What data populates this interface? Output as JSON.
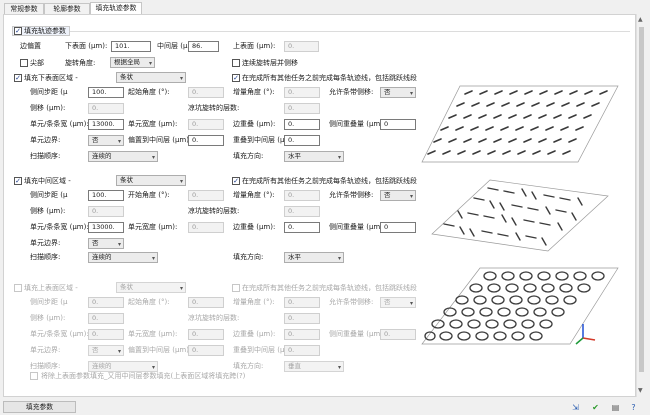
{
  "tabs": [
    "常规参数",
    "轮廓参数",
    "填充轨迹参数"
  ],
  "header": {
    "label": "填充轨迹参数",
    "checked": true
  },
  "top": {
    "l_offset": "边偏置",
    "l_lower": "下表面 (μm):",
    "lower_val": "101.",
    "l_mid": "中间层 (μ",
    "mid_val": "86.",
    "l_upper": "上表面 (μm):",
    "upper_val": "0.",
    "l_tip": "尖部",
    "l_rot": "旋转角度:",
    "rot_sel": "根据全局",
    "l_cont": "连续旋转层并侧移"
  },
  "sections": [
    {
      "title": "填充下表面区域 -",
      "style": "条状",
      "sync": "在完成所有其他任务之前完成每条轨迹线，包括跳跃线段",
      "l_side": "侧间步距 (μ",
      "side_val": "100.",
      "l_start": "起始角度 (°):",
      "start_val": "0.",
      "l_inc": "增量角度 (°):",
      "inc_val": "0.",
      "l_allow": "允许条带侧移:",
      "allow_sel": "否",
      "l_sideshift": "侧移 (μm):",
      "sideshift_val": "0.",
      "l_contcnt": "凉坑旋转的层数:",
      "contcnt_val": "0.",
      "l_unit": "单元/条条宽 (μm):",
      "unit_val": "13000.",
      "l_unitw": "单元宽度 (μm):",
      "unitw_val": "0.",
      "l_overlap": "边重叠 (μm):",
      "overlap_val": "0.",
      "l_sideoverlap": "侧间重叠量 (μm):",
      "sideoverlap_val": "0",
      "l_border": "单元边界:",
      "border_sel": "否",
      "l_biasmid": "偏置到中间层 (μm):",
      "biasmid_val": "0.",
      "l_overlapmid": "重叠到中间层 (μ",
      "overlapmid_val": "0.",
      "l_order": "扫描顺序:",
      "order_sel": "连续的",
      "l_dir": "填充方向:",
      "dir_sel": "水平"
    },
    {
      "title": "填充中间区域 -",
      "style": "条状",
      "sync": "在完成所有其他任务之前完成每条轨迹线，包括跳跃线段",
      "l_side": "侧间步距 (μ",
      "side_val": "100.",
      "l_start": "开始角度 (°):",
      "start_val": "0.",
      "l_inc": "增量角度 (°):",
      "inc_val": "0.",
      "l_allow": "允许条带侧移:",
      "allow_sel": "否",
      "l_sideshift": "侧移 (μm):",
      "sideshift_val": "0.",
      "l_contcnt": "凉坑旋转的层数:",
      "contcnt_val": "0.",
      "l_unit": "单元/条条宽 (μm):",
      "unit_val": "13000.",
      "l_unitw": "单元宽度 (μm):",
      "unitw_val": "0.",
      "l_overlap": "边重叠 (μm):",
      "overlap_val": "0.",
      "l_sideoverlap": "侧间重叠量 (μm):",
      "sideoverlap_val": "0",
      "l_border": "单元边界:",
      "border_sel": "否",
      "l_order": "扫描顺序:",
      "order_sel": "连续的",
      "l_dir": "填充方向:",
      "dir_sel": "水平"
    },
    {
      "title": "填充上表面区域 -",
      "style": "条状",
      "sync": "在完成所有其他任务之前完成每条轨迹线，包括跳跃线段",
      "l_side": "侧间步距 (μ",
      "side_val": "0.",
      "l_start": "起始角度 (°):",
      "start_val": "0.",
      "l_inc": "增量角度 (°):",
      "inc_val": "0.",
      "l_allow": "允许条带侧移:",
      "allow_sel": "否",
      "l_sideshift": "侧移 (μm):",
      "sideshift_val": "0.",
      "l_contcnt": "凉坑旋转的层数:",
      "contcnt_val": "0.",
      "l_unit": "单元/条条宽 (μm):",
      "unit_val": "0.",
      "l_unitw": "单元宽度 (μm):",
      "unitw_val": "0.",
      "l_overlap": "边重叠 (μm):",
      "overlap_val": "0.",
      "l_sideoverlap": "侧间重叠量 (μm):",
      "sideoverlap_val": "0.",
      "l_border": "单元边界:",
      "border_sel": "否",
      "l_biasmid": "偏置到中间层 (μm):",
      "biasmid_val": "0.",
      "l_overlapmid": "重叠到中间层 (μ",
      "overlapmid_val": "0.",
      "l_order": "扫描顺序:",
      "order_sel": "连续的",
      "l_dir": "填充方向:",
      "dir_sel": "垂直"
    }
  ],
  "footnote": "将除上表面参数填充_又用中间层参数填充(上表面区域将填充跨(?)",
  "bottom_button": "填充参数",
  "toolbar_icons": [
    "import-icon",
    "check-icon",
    "export-icon",
    "help-icon"
  ]
}
